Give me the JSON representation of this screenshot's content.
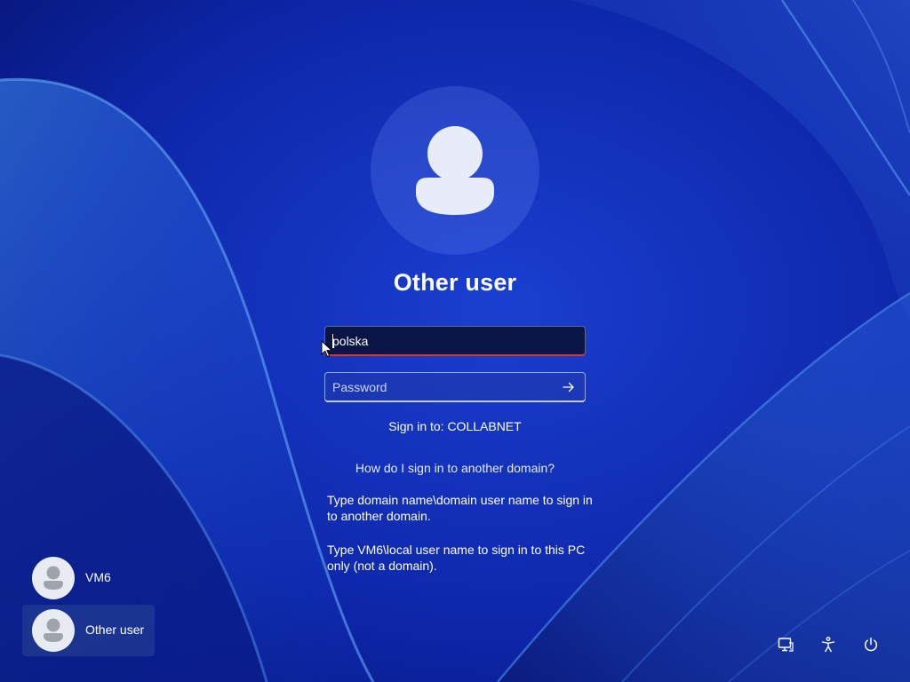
{
  "login": {
    "title": "Other user",
    "username_value": "polska",
    "password_placeholder": "Password",
    "sign_in_to": "Sign in to: COLLABNET",
    "help_link": "How do I sign in to another domain?",
    "help_text_1": "Type domain name\\domain user name to sign in to another domain.",
    "help_text_2": "Type VM6\\local user name to sign in to this PC only (not a domain)."
  },
  "users": [
    {
      "name": "VM6",
      "selected": false
    },
    {
      "name": "Other user",
      "selected": true
    }
  ],
  "icons": {
    "submit": "arrow-right-icon",
    "network": "network-icon",
    "accessibility": "accessibility-icon",
    "power": "power-icon"
  },
  "colors": {
    "background": "#0b1f8f",
    "input_error_underline": "#e0332c",
    "avatar_fill": "#e8ebf2"
  }
}
